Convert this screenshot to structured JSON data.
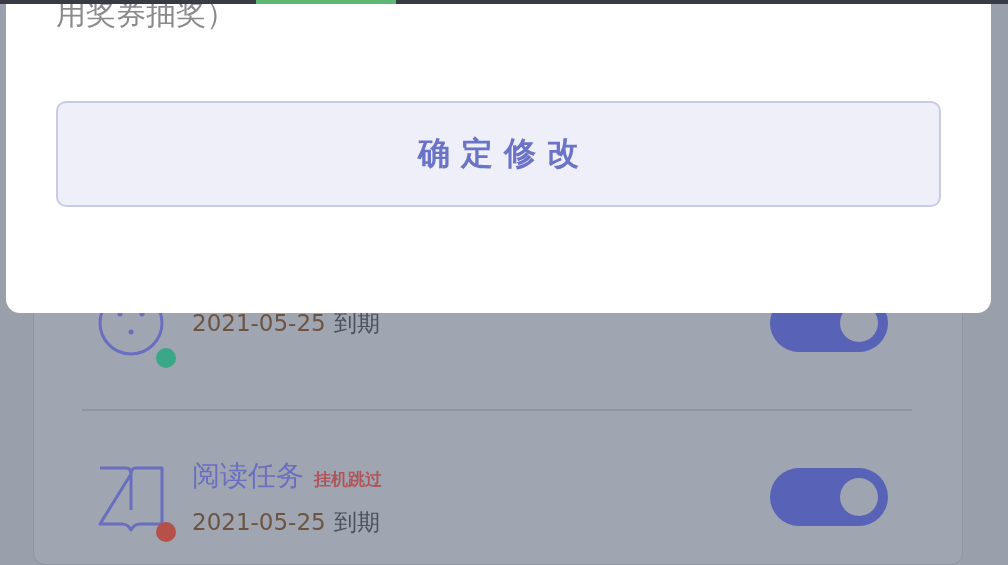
{
  "dialog": {
    "note": "用奖券抽奖）",
    "confirm_button": "确 定 修 改"
  },
  "tasks": [
    {
      "kind": "dots",
      "color": "#3aa888",
      "date": "2021-05-25",
      "suffix": "到期",
      "on": true
    },
    {
      "kind": "book",
      "title": "阅读任务",
      "tag": "挂机跳过",
      "color": "#b6514a",
      "date": "2021-05-25",
      "suffix": "到期",
      "on": true
    }
  ]
}
